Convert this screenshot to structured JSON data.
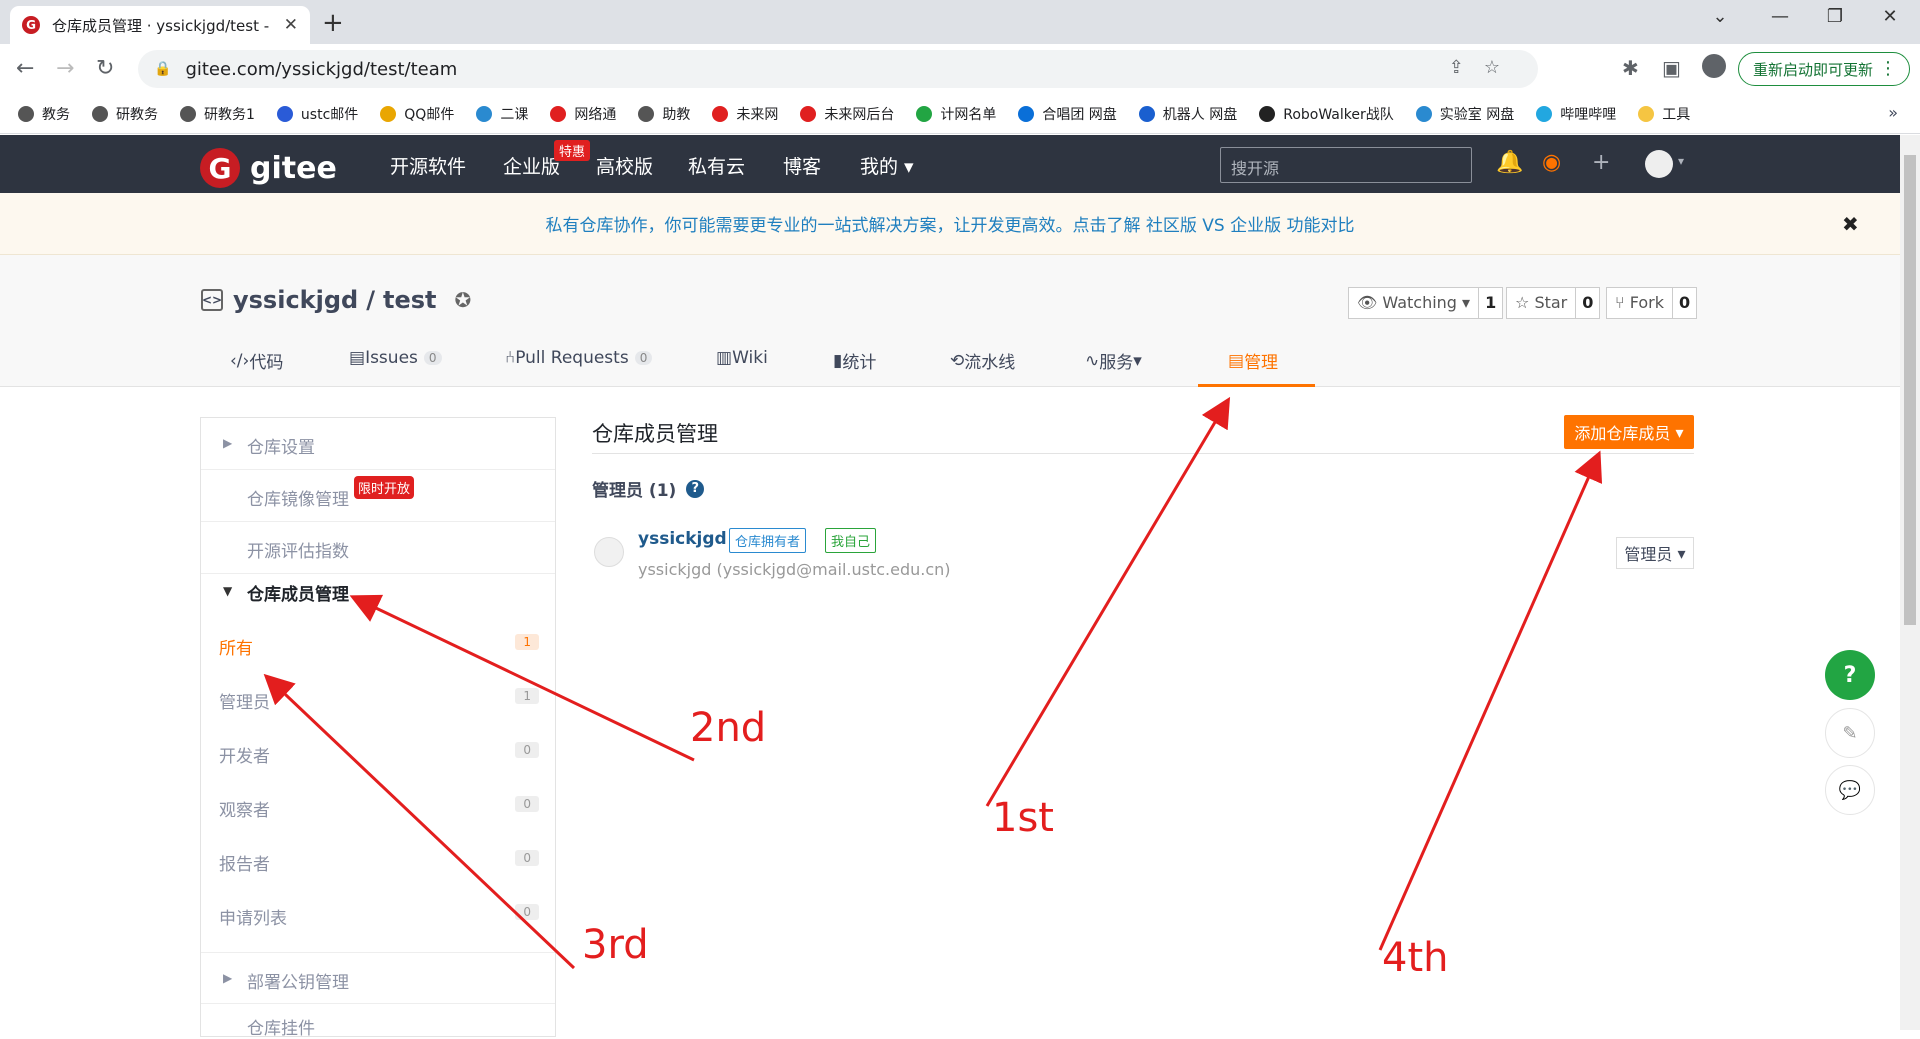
{
  "browser": {
    "tab_title": "仓库成员管理 · yssickjgd/test -",
    "url": "gitee.com/yssickjgd/test/team",
    "update_label": "重新启动即可更新",
    "bookmarks": [
      "教务",
      "研教务",
      "研教务1",
      "ustc邮件",
      "QQ邮件",
      "二课",
      "网络通",
      "助教",
      "未来网",
      "未来网后台",
      "计网名单",
      "合唱团 网盘",
      "机器人 网盘",
      "RoboWalker战队",
      "实验室 网盘",
      "哔哩哔哩",
      "工具"
    ],
    "bookmark_more": "»"
  },
  "header": {
    "logo_text": "gitee",
    "nav": [
      "开源软件",
      "企业版",
      "高校版",
      "私有云",
      "博客",
      "我的"
    ],
    "promo_badge": "特惠",
    "search_placeholder": "搜开源"
  },
  "notice": {
    "text": "私有仓库协作，你可能需要更专业的一站式解决方案，让开发更高效。点击了解 社区版 VS 企业版 功能对比",
    "close": "✖"
  },
  "repo": {
    "owner": "yssickjgd",
    "sep": "/",
    "name": "test",
    "watch_label": "Watching",
    "watch_count": "1",
    "star_label": "Star",
    "star_count": "0",
    "fork_label": "Fork",
    "fork_count": "0",
    "tabs": [
      {
        "label": "代码"
      },
      {
        "label": "Issues",
        "count": "0"
      },
      {
        "label": "Pull Requests",
        "count": "0"
      },
      {
        "label": "Wiki"
      },
      {
        "label": "统计"
      },
      {
        "label": "流水线"
      },
      {
        "label": "服务"
      },
      {
        "label": "管理"
      }
    ]
  },
  "sidebar": {
    "repo_settings": "仓库设置",
    "mirror": "仓库镜像管理",
    "limited_badge": "限时开放",
    "oss_index": "开源评估指数",
    "member_mgmt": "仓库成员管理",
    "members": [
      {
        "label": "所有",
        "count": "1"
      },
      {
        "label": "管理员",
        "count": "1"
      },
      {
        "label": "开发者",
        "count": "0"
      },
      {
        "label": "观察者",
        "count": "0"
      },
      {
        "label": "报告者",
        "count": "0"
      },
      {
        "label": "申请列表",
        "count": "0"
      }
    ],
    "deploy_keys": "部署公钥管理",
    "plugins": "仓库挂件"
  },
  "main": {
    "title": "仓库成员管理",
    "add_button": "添加仓库成员",
    "admins_heading": "管理员 (1)",
    "member": {
      "name": "yssickjgd",
      "tag_owner": "仓库拥有者",
      "tag_self": "我自己",
      "email": "yssickjgd (yssickjgd@mail.ustc.edu.cn)",
      "role": "管理员"
    }
  },
  "annotations": [
    "1st",
    "2nd",
    "3rd",
    "4th"
  ],
  "colors": {
    "accent": "#fe7300",
    "annotation": "#e31e1e",
    "header_bg": "#2e3440"
  }
}
